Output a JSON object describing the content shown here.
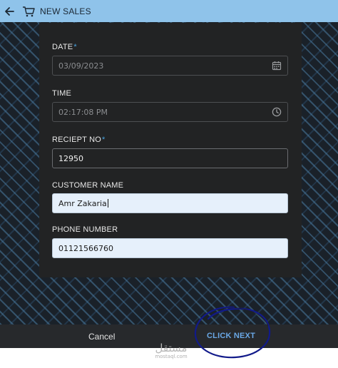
{
  "header": {
    "title": "NEW SALES",
    "background_color": "#8fc3ea"
  },
  "form": {
    "date": {
      "label": "DATE",
      "required_mark": "*",
      "value": "03/09/2023",
      "icon": "calendar-icon"
    },
    "time": {
      "label": "TIME",
      "value": "02:17:08 PM",
      "icon": "clock-icon"
    },
    "receipt": {
      "label": "RECIEPT NO",
      "required_mark": "*",
      "value": "12950"
    },
    "customer": {
      "label": "CUSTOMER NAME",
      "value": "Amr Zakaria"
    },
    "phone": {
      "label": "PHONE NUMBER",
      "value": "01121566760"
    }
  },
  "footer": {
    "cancel_label": "Cancel",
    "next_label": "CLICK NEXT",
    "accent_color": "#6aa8e6"
  },
  "watermark": {
    "arabic": "مستقل",
    "latin": "mostaql.com"
  }
}
